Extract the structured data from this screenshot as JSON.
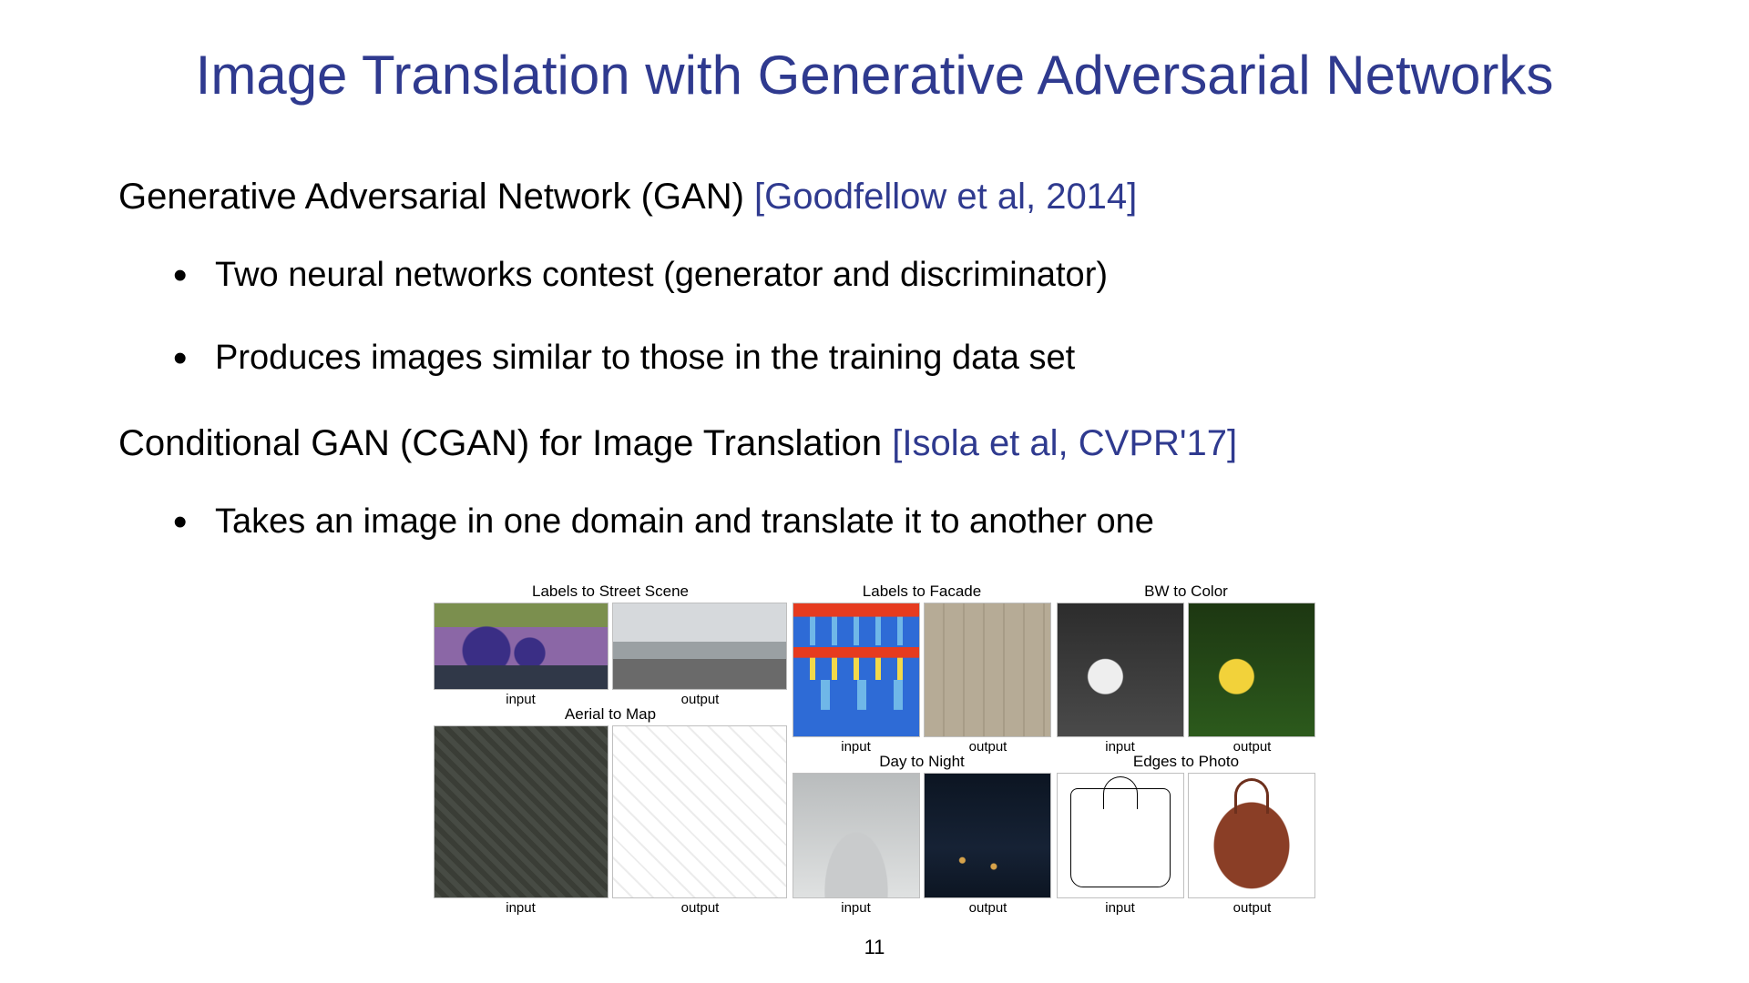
{
  "title": "Image Translation with Generative Adversarial Networks",
  "section1": {
    "text": "Generative Adversarial Network (GAN) ",
    "ref": "[Goodfellow et al, 2014]",
    "bullets": [
      "Two neural networks contest (generator and discriminator)",
      "Produces images similar to those in the training data set"
    ]
  },
  "section2": {
    "text": "Conditional GAN (CGAN) for Image Translation ",
    "ref": "[Isola et al, CVPR'17]",
    "bullets": [
      "Takes an image in one domain and translate it to another one"
    ]
  },
  "figure": {
    "captions": {
      "input": "input",
      "output": "output"
    },
    "labels_street": "Labels to Street Scene",
    "aerial_map": "Aerial to Map",
    "labels_facade": "Labels to Facade",
    "day_night": "Day to Night",
    "bw_color": "BW to Color",
    "edges_photo": "Edges to Photo"
  },
  "page_number": "11"
}
